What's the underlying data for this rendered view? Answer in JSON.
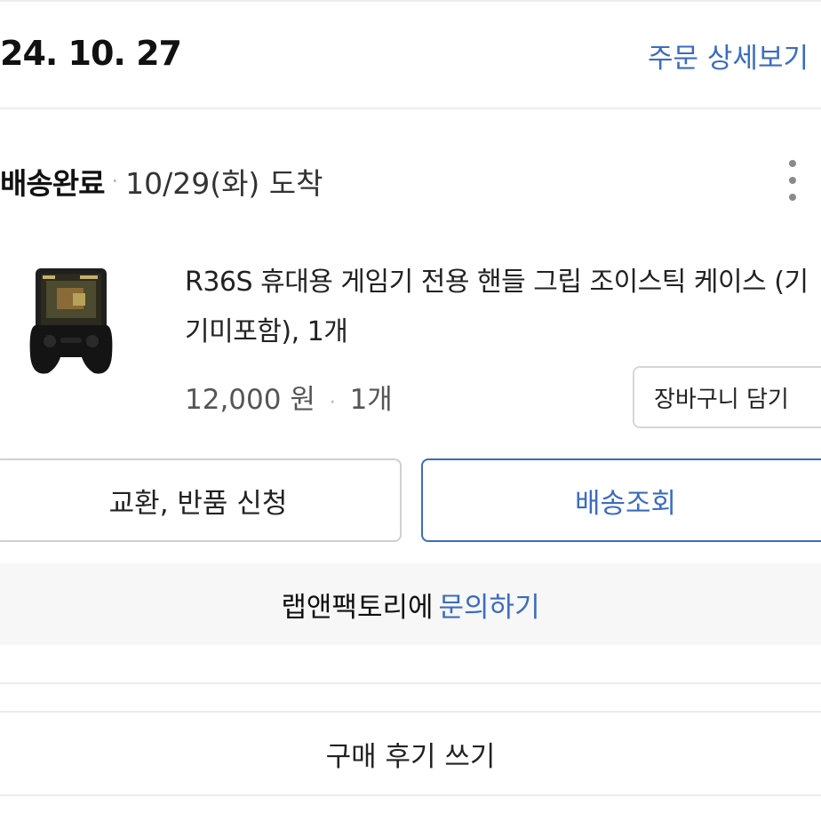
{
  "order": {
    "date": "24. 10. 27",
    "detail_link": "주문 상세보기"
  },
  "shipment": {
    "status": "배송완료",
    "separator": "·",
    "arrival": "10/29(화) 도착"
  },
  "product": {
    "name": "R36S 휴대용 게임기 전용 핸들 그립 조이스틱 케이스 (기기미포함), 1개",
    "price": "12,000 원",
    "separator": "·",
    "quantity": "1개",
    "cart_button": "장바구니 담기"
  },
  "actions": {
    "exchange_return": "교환, 반품 신청",
    "tracking": "배송조회"
  },
  "inquiry": {
    "seller_text": "랩앤팩토리에",
    "link": "문의하기"
  },
  "review": {
    "label": "구매 후기 쓰기"
  },
  "colors": {
    "accent": "#3b6cbf",
    "divider": "#ececec",
    "inquiry_bg": "#f7f7f7"
  },
  "icons": {
    "more": "more-vertical-icon"
  }
}
